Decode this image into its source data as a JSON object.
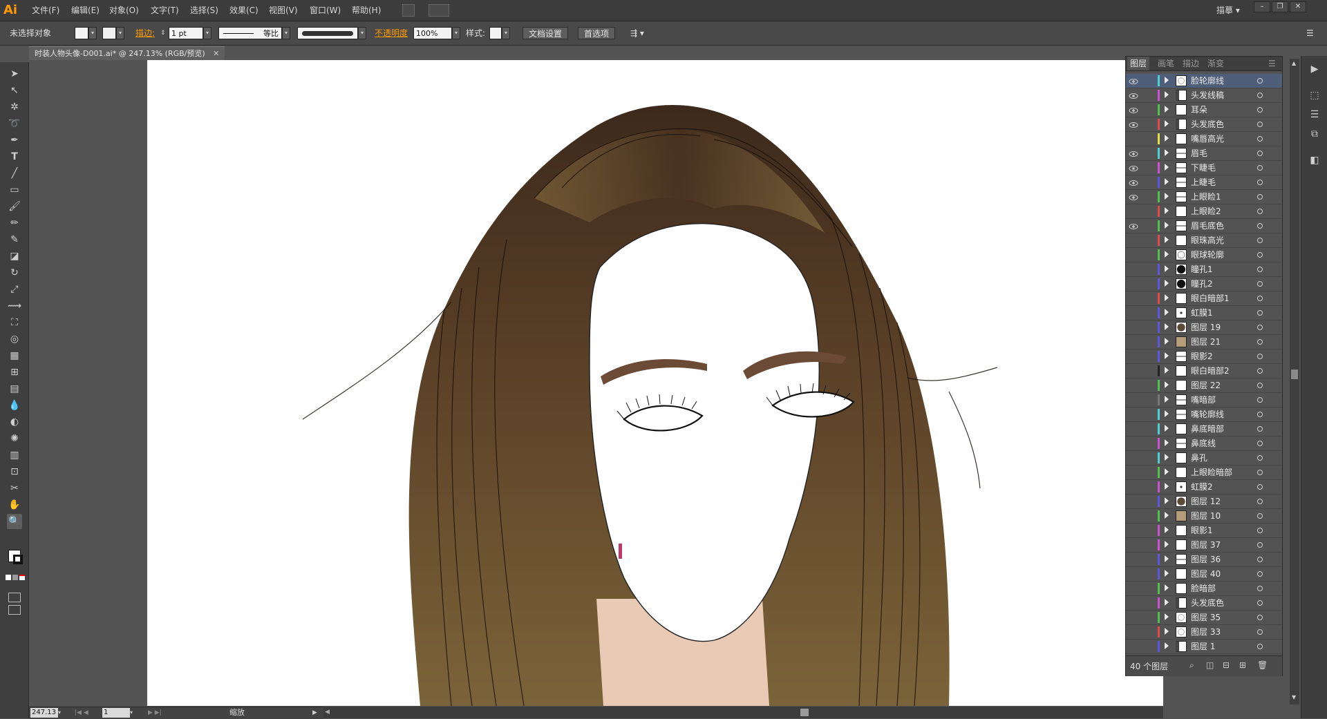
{
  "app": {
    "logo": "Ai"
  },
  "menu": [
    "文件(F)",
    "编辑(E)",
    "对象(O)",
    "文字(T)",
    "选择(S)",
    "效果(C)",
    "视图(V)",
    "窗口(W)",
    "帮助(H)"
  ],
  "workspace": {
    "label": "描摹"
  },
  "control_bar": {
    "selection": "未选择对象",
    "stroke_label": "描边:",
    "stroke_weight": "1 pt",
    "stroke_profile": "等比",
    "opacity_label": "不透明度",
    "opacity_value": "100%",
    "style_label": "样式:",
    "doc_setup": "文档设置",
    "preferences": "首选项"
  },
  "document_tab": {
    "title": "时装人物头像-D001.ai* @ 247.13% (RGB/预览)"
  },
  "status_bar": {
    "zoom": "247.13",
    "artboard": "1",
    "tool": "缩放"
  },
  "layers_panel": {
    "tabs": [
      "图层",
      "画笔",
      "描边",
      "渐变"
    ],
    "count_label": "40 个图层",
    "layers": [
      {
        "name": "脸轮廓线",
        "visible": true,
        "color": "#4fd0d0",
        "thumb": "face",
        "selected": true
      },
      {
        "name": "头发线稿",
        "visible": true,
        "color": "#d34fd3",
        "thumb": "hair"
      },
      {
        "name": "耳朵",
        "visible": true,
        "color": "#4fc24f",
        "thumb": "plain"
      },
      {
        "name": "头发底色",
        "visible": true,
        "color": "#e04a4a",
        "thumb": "hair"
      },
      {
        "name": "嘴唇高光",
        "visible": false,
        "color": "#e0e04a",
        "thumb": "plain"
      },
      {
        "name": "眉毛",
        "visible": true,
        "color": "#4fd0d0",
        "thumb": "line"
      },
      {
        "name": "下睫毛",
        "visible": true,
        "color": "#d34fd3",
        "thumb": "line"
      },
      {
        "name": "上睫毛",
        "visible": true,
        "color": "#5a5ae0",
        "thumb": "line"
      },
      {
        "name": "上眼睑1",
        "visible": true,
        "color": "#4fc24f",
        "thumb": "line"
      },
      {
        "name": "上眼睑2",
        "visible": false,
        "color": "#e04a4a",
        "thumb": "plain"
      },
      {
        "name": "眉毛底色",
        "visible": true,
        "color": "#4fc24f",
        "thumb": "line"
      },
      {
        "name": "眼珠高光",
        "visible": false,
        "color": "#e04a4a",
        "thumb": "plain"
      },
      {
        "name": "眼球轮廓",
        "visible": false,
        "color": "#4fc24f",
        "thumb": "circle"
      },
      {
        "name": "瞳孔1",
        "visible": false,
        "color": "#5a5ae0",
        "thumb": "dot"
      },
      {
        "name": "瞳孔2",
        "visible": false,
        "color": "#5a5ae0",
        "thumb": "dot"
      },
      {
        "name": "眼白暗部1",
        "visible": false,
        "color": "#e04a4a",
        "thumb": "plain"
      },
      {
        "name": "虹膜1",
        "visible": false,
        "color": "#5a5ae0",
        "thumb": "small"
      },
      {
        "name": "图层 19",
        "visible": false,
        "color": "#5a5ae0",
        "thumb": "brown"
      },
      {
        "name": "图层 21",
        "visible": false,
        "color": "#5a5ae0",
        "thumb": "tan"
      },
      {
        "name": "眼影2",
        "visible": false,
        "color": "#5a5ae0",
        "thumb": "line"
      },
      {
        "name": "眼白暗部2",
        "visible": false,
        "color": "#222222",
        "thumb": "plain"
      },
      {
        "name": "图层 22",
        "visible": false,
        "color": "#4fc24f",
        "thumb": "plain"
      },
      {
        "name": "嘴暗部",
        "visible": false,
        "color": "#777777",
        "thumb": "line"
      },
      {
        "name": "嘴轮廓线",
        "visible": false,
        "color": "#4fd0d0",
        "thumb": "line"
      },
      {
        "name": "鼻底暗部",
        "visible": false,
        "color": "#4fd0d0",
        "thumb": "plain"
      },
      {
        "name": "鼻底线",
        "visible": false,
        "color": "#d34fd3",
        "thumb": "line"
      },
      {
        "name": "鼻孔",
        "visible": false,
        "color": "#4fd0d0",
        "thumb": "plain"
      },
      {
        "name": "上眼睑暗部",
        "visible": false,
        "color": "#4fc24f",
        "thumb": "plain"
      },
      {
        "name": "虹膜2",
        "visible": false,
        "color": "#d34fd3",
        "thumb": "small"
      },
      {
        "name": "图层 12",
        "visible": false,
        "color": "#5a5ae0",
        "thumb": "brown"
      },
      {
        "name": "图层 10",
        "visible": false,
        "color": "#4fc24f",
        "thumb": "tan"
      },
      {
        "name": "眼影1",
        "visible": false,
        "color": "#d34fd3",
        "thumb": "plain"
      },
      {
        "name": "图层 37",
        "visible": false,
        "color": "#d34fd3",
        "thumb": "plain"
      },
      {
        "name": "图层 36",
        "visible": false,
        "color": "#5a5ae0",
        "thumb": "line"
      },
      {
        "name": "图层 40",
        "visible": false,
        "color": "#5a5ae0",
        "thumb": "plain"
      },
      {
        "name": "脸暗部",
        "visible": false,
        "color": "#4fc24f",
        "thumb": "plain"
      },
      {
        "name": "头发底色",
        "visible": false,
        "color": "#d34fd3",
        "thumb": "hair"
      },
      {
        "name": "图层 35",
        "visible": false,
        "color": "#4fc24f",
        "thumb": "face"
      },
      {
        "name": "图层 33",
        "visible": false,
        "color": "#e04a4a",
        "thumb": "face"
      },
      {
        "name": "图层 1",
        "visible": false,
        "color": "#5a5ae0",
        "thumb": "hair"
      }
    ]
  }
}
